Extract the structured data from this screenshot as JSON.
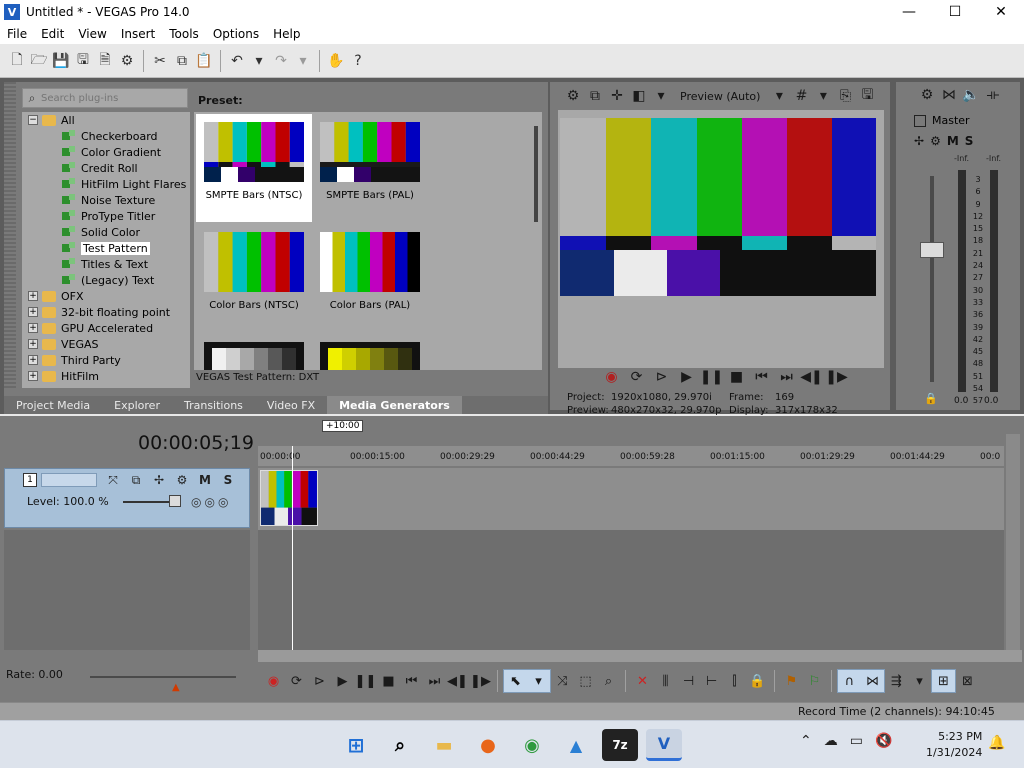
{
  "window": {
    "title": "Untitled * - VEGAS Pro 14.0",
    "logo": "V",
    "controls": [
      "—",
      "☐",
      "✕"
    ]
  },
  "menu": [
    "File",
    "Edit",
    "View",
    "Insert",
    "Tools",
    "Options",
    "Help"
  ],
  "plugins": {
    "search_placeholder": "Search plug-ins",
    "tree": [
      {
        "label": "All",
        "kind": "folder",
        "expanded": true,
        "level": 0
      },
      {
        "label": "Checkerboard",
        "kind": "plugin",
        "level": 1
      },
      {
        "label": "Color Gradient",
        "kind": "plugin",
        "level": 1
      },
      {
        "label": "Credit Roll",
        "kind": "plugin",
        "level": 1
      },
      {
        "label": "HitFilm Light Flares",
        "kind": "plugin",
        "level": 1
      },
      {
        "label": "Noise Texture",
        "kind": "plugin",
        "level": 1
      },
      {
        "label": "ProType Titler",
        "kind": "plugin",
        "level": 1
      },
      {
        "label": "Solid Color",
        "kind": "plugin",
        "level": 1
      },
      {
        "label": "Test Pattern",
        "kind": "plugin",
        "level": 1,
        "selected": true
      },
      {
        "label": "Titles & Text",
        "kind": "plugin",
        "level": 1
      },
      {
        "label": "(Legacy) Text",
        "kind": "plugin",
        "level": 1
      },
      {
        "label": "OFX",
        "kind": "folder",
        "level": 0
      },
      {
        "label": "32-bit floating point",
        "kind": "folder",
        "level": 0
      },
      {
        "label": "GPU Accelerated",
        "kind": "folder",
        "level": 0
      },
      {
        "label": "VEGAS",
        "kind": "folder",
        "level": 0
      },
      {
        "label": "Third Party",
        "kind": "folder",
        "level": 0
      },
      {
        "label": "HitFilm",
        "kind": "folder",
        "level": 0
      }
    ],
    "preset_label": "Preset:",
    "presets": [
      {
        "name": "SMPTE Bars (NTSC)",
        "selected": true
      },
      {
        "name": "SMPTE Bars (PAL)"
      },
      {
        "name": "Color Bars (NTSC)"
      },
      {
        "name": "Color Bars (PAL)"
      },
      {
        "name": ""
      },
      {
        "name": ""
      }
    ],
    "status": "VEGAS Test Pattern: DXT"
  },
  "tabs": [
    "Project Media",
    "Explorer",
    "Transitions",
    "Video FX",
    "Media Generators"
  ],
  "active_tab": "Media Generators",
  "preview": {
    "quality": "Preview (Auto)",
    "project_label": "Project:",
    "project_value": "1920x1080, 29.970i",
    "preview_label": "Preview:",
    "preview_value": "480x270x32, 29.970p",
    "frame_label": "Frame:",
    "frame_value": "169",
    "display_label": "Display:",
    "display_value": "317x178x32"
  },
  "master": {
    "title": "Master",
    "m": "M",
    "s": "S",
    "inf": "-Inf.",
    "scale": [
      "3",
      "6",
      "9",
      "12",
      "15",
      "18",
      "21",
      "24",
      "27",
      "30",
      "33",
      "36",
      "39",
      "42",
      "45",
      "48",
      "51",
      "54",
      "57"
    ],
    "left_value": "0.0",
    "right_value": "0.0"
  },
  "timeline": {
    "timecode": "00:00:05;19",
    "offset": "+10:00",
    "ruler": [
      "00:00:00",
      "00:00:15:00",
      "00:00:29:29",
      "00:00:44:29",
      "00:00:59:28",
      "00:01:15:00",
      "00:01:29:29",
      "00:01:44:29",
      "00:0"
    ],
    "track_number": "1",
    "level": "Level: 100.0 %",
    "m": "M",
    "s": "S",
    "rate": "Rate: 0.00"
  },
  "status": {
    "record_time": "Record Time (2 channels): 94:10:45"
  },
  "taskbar": {
    "time": "5:23 PM",
    "date": "1/31/2024",
    "app_7z": "7z"
  },
  "colors": {
    "accent": "#2f6fd6",
    "selected_track": "#a7c0d8"
  }
}
